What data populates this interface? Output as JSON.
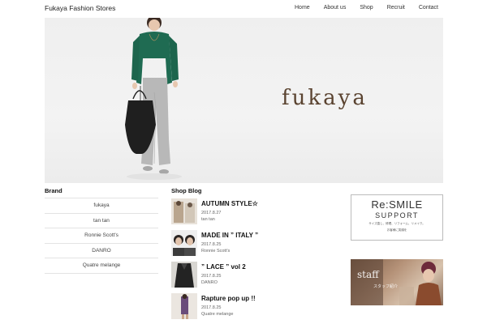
{
  "header": {
    "site_title": "Fukaya Fashion Stores",
    "nav": [
      "Home",
      "About us",
      "Shop",
      "Recruit",
      "Contact"
    ]
  },
  "hero": {
    "logo_text": "fukaya"
  },
  "brand": {
    "title": "Brand",
    "items": [
      "fukaya",
      "tan tan",
      "Ronnie Scott's",
      "DANRO",
      "Quatre melange"
    ]
  },
  "blog": {
    "title": "Shop Blog",
    "posts": [
      {
        "title": "AUTUMN STYLE☆",
        "date": "2017.8.27",
        "brand": "tan tan"
      },
      {
        "title": "MADE IN ” ITALY ”",
        "date": "2017.8.25",
        "brand": "Ronnie Scott's"
      },
      {
        "title": "” LACE ” vol 2",
        "date": "2017.8.25",
        "brand": "DANRO"
      },
      {
        "title": "Rapture pop up !!",
        "date": "2017.8.25",
        "brand": "Quatre melange"
      }
    ]
  },
  "banners": {
    "resmile_main": "Re:SMILE",
    "resmile_sub": "SUPPORT",
    "resmile_note_1": "サイズ直し、修理、リフォーム、リメイク。",
    "resmile_note_2": "お客様に笑顔を",
    "staff_text": "staff",
    "staff_sub": "スタッフ紹介"
  },
  "colors": {
    "logo": "#5a4330",
    "cardigan": "#1f6b52"
  }
}
